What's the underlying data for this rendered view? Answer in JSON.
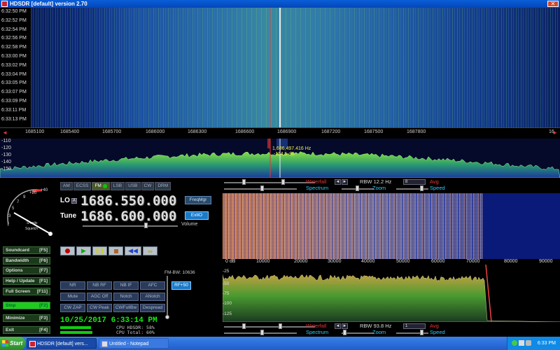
{
  "window": {
    "title": "HDSDR [default]  version 2.70",
    "close_glyph": "✕"
  },
  "waterfall_top": {
    "times": [
      "6:32:50 PM",
      "6:32:52 PM",
      "6:32:54 PM",
      "6:32:56 PM",
      "6:32:58 PM",
      "6:33:00 PM",
      "6:33:02 PM",
      "6:33:04 PM",
      "6:33:05 PM",
      "6:33:07 PM",
      "6:33:09 PM",
      "6:33:11 PM",
      "6:33:13 PM"
    ]
  },
  "freq_axis": {
    "ticks": [
      "1685100",
      "1685400",
      "1685700",
      "1686000",
      "1686300",
      "1686600",
      "1686900",
      "1687200",
      "1687500",
      "1687800",
      "16"
    ]
  },
  "spectrum_top": {
    "db_labels": [
      "-110",
      "-120",
      "-130",
      "-140",
      "-150"
    ],
    "marker_freq": "1,686,497.416 Hz",
    "marker_level": "-114.5 dB"
  },
  "modes": [
    {
      "label": "AM",
      "on": false
    },
    {
      "label": "ECSS",
      "on": false
    },
    {
      "label": "FM",
      "on": true
    },
    {
      "label": "LSB",
      "on": false
    },
    {
      "label": "USB",
      "on": false
    },
    {
      "label": "CW",
      "on": false
    },
    {
      "label": "DRM",
      "on": false
    }
  ],
  "smeter": {
    "scale": [
      "1",
      "3",
      "5",
      "7",
      "9",
      "+20",
      "+40"
    ],
    "label": "S-units",
    "sublabel": "Squelch"
  },
  "lo": {
    "label": "LO",
    "tag": "A",
    "value": "1686.550.000"
  },
  "tune": {
    "label": "Tune",
    "value": "1686.600.000"
  },
  "buttons": {
    "freqmgr": "FreqMgr",
    "extio": "ExtIO",
    "volume": "Volume",
    "fm_bw": "FM-BW: 10636",
    "rf50": "RF+50"
  },
  "side_buttons": [
    {
      "label": "Soundcard",
      "key": "[F5]"
    },
    {
      "label": "Bandwidth",
      "key": "[F6]"
    },
    {
      "label": "Options",
      "key": "[F7]"
    },
    {
      "label": "Help / Update",
      "key": "[F1]"
    },
    {
      "label": "Full Screen",
      "key": "[F11]"
    },
    {
      "label": "Stop",
      "key": "[F2]"
    },
    {
      "label": "Minimize",
      "key": "[F3]"
    },
    {
      "label": "Exit",
      "key": "[F4]"
    }
  ],
  "dsp_buttons": [
    [
      "NR",
      "NB RF",
      "NB IF",
      "AFC"
    ],
    [
      "Mute",
      "AGC Off",
      "Notch",
      "ANotch"
    ],
    [
      "CW ZAP",
      "CW Peak",
      "CWFullBw",
      "Despread"
    ]
  ],
  "status": {
    "datetime": "10/25/2017 6:33:14 PM",
    "cpu_hdsdr": "CPU HDSDR:  58%",
    "cpu_total": "CPU Total:  60%",
    "cpu_hdsdr_fraction": 0.58,
    "cpu_total_fraction": 0.6
  },
  "rf_ctrl": {
    "waterfall": "Waterfall",
    "spectrum": "Spectrum",
    "rbw": "RBW 12.2 Hz",
    "rbw_select": "8",
    "avg": "Avg",
    "zoom": "Zoom",
    "speed": "Speed"
  },
  "af_ctrl": {
    "waterfall": "Waterfall",
    "spectrum": "Spectrum",
    "rbw": "RBW 93.8 Hz",
    "rbw_select": "1",
    "avg": "Avg",
    "zoom": "Zoom",
    "speed": "Speed"
  },
  "af_axis": {
    "ticks": [
      "0 dB",
      "10000",
      "20000",
      "30000",
      "40000",
      "50000",
      "60000",
      "70000",
      "80000",
      "90000"
    ]
  },
  "af_spectrum": {
    "db_labels": [
      "-25",
      "-50",
      "-75",
      "-100",
      "-125"
    ]
  },
  "taskbar": {
    "start": "Start",
    "tasks": [
      "HDSDR [default]  vers...",
      "Untitled - Notepad"
    ],
    "clock": "6:33 PM"
  },
  "colors": {
    "accent_blue": "#1a7ac8",
    "mode_on_led": "#00cc00",
    "datetime_green": "#11ee11",
    "waterfall_red": "#ee3333",
    "spectrum_cyan": "#33ccff"
  }
}
